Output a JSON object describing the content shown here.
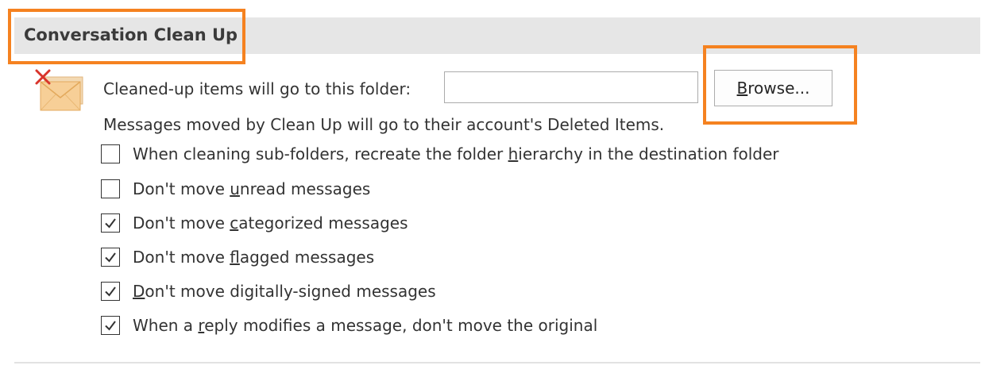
{
  "section": {
    "title": "Conversation Clean Up"
  },
  "cleanup": {
    "icon": "cleanup-envelope-icon",
    "folder_label": "Cleaned-up items will go to this folder:",
    "folder_value": "",
    "browse_label": "Browse...",
    "info_text": "Messages moved by Clean Up will go to their account's Deleted Items."
  },
  "options": [
    {
      "label": "When cleaning sub-folders, recreate the folder hierarchy in the destination folder",
      "checked": false,
      "accesskey": "h"
    },
    {
      "label": "Don't move unread messages",
      "checked": false,
      "accesskey": "u"
    },
    {
      "label": "Don't move categorized messages",
      "checked": true,
      "accesskey": "c"
    },
    {
      "label": "Don't move flagged messages",
      "checked": true,
      "accesskey": "f"
    },
    {
      "label": "Don't move digitally-signed messages",
      "checked": true,
      "accesskey": "d"
    },
    {
      "label": "When a reply modifies a message, don't move the original",
      "checked": true,
      "accesskey": "r"
    }
  ],
  "colors": {
    "highlight": "#f58220",
    "header_background": "#e6e6e6",
    "icon_envelope": "#f5c688",
    "icon_x": "#d9342b"
  }
}
